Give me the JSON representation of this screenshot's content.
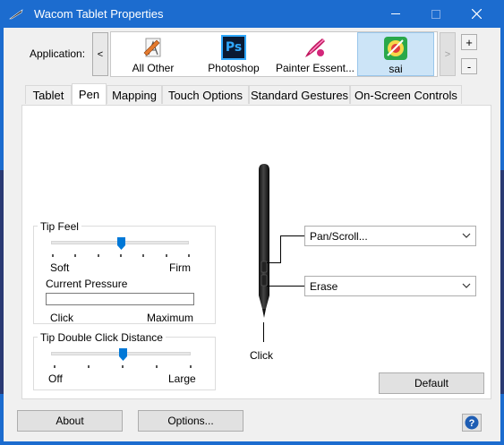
{
  "window": {
    "title": "Wacom Tablet Properties",
    "accent": "#1c6ccf"
  },
  "application": {
    "label": "Application:",
    "scroll_left": "<",
    "scroll_right": ">",
    "add": "+",
    "remove": "-",
    "items": [
      {
        "label": "All Other",
        "icon": "all-other-icon",
        "selected": false
      },
      {
        "label": "Photoshop",
        "icon": "photoshop-icon",
        "icon_text": "Ps",
        "selected": false
      },
      {
        "label": "Painter Essent...",
        "icon": "painter-icon",
        "selected": false
      },
      {
        "label": "sai",
        "icon": "sai-icon",
        "selected": true
      }
    ]
  },
  "tabs": [
    {
      "label": "Tablet",
      "active": false
    },
    {
      "label": "Pen",
      "active": true
    },
    {
      "label": "Mapping",
      "active": false
    },
    {
      "label": "Touch Options",
      "active": false
    },
    {
      "label": "Standard Gestures",
      "active": false
    },
    {
      "label": "On-Screen Controls",
      "active": false
    }
  ],
  "tip_feel": {
    "title": "Tip Feel",
    "min_label": "Soft",
    "max_label": "Firm",
    "value_step": 3,
    "step_count": 7,
    "current_pressure_label": "Current Pressure",
    "pressure_fraction": 0,
    "pressure_min_label": "Click",
    "pressure_max_label": "Maximum"
  },
  "tip_double_click": {
    "title": "Tip Double Click Distance",
    "min_label": "Off",
    "max_label": "Large",
    "value_step": 2,
    "step_count": 5
  },
  "pen": {
    "upper_button": "Pan/Scroll...",
    "lower_button": "Erase",
    "tip_label": "Click"
  },
  "buttons": {
    "default": "Default",
    "about": "About",
    "options": "Options...",
    "help": "?"
  }
}
